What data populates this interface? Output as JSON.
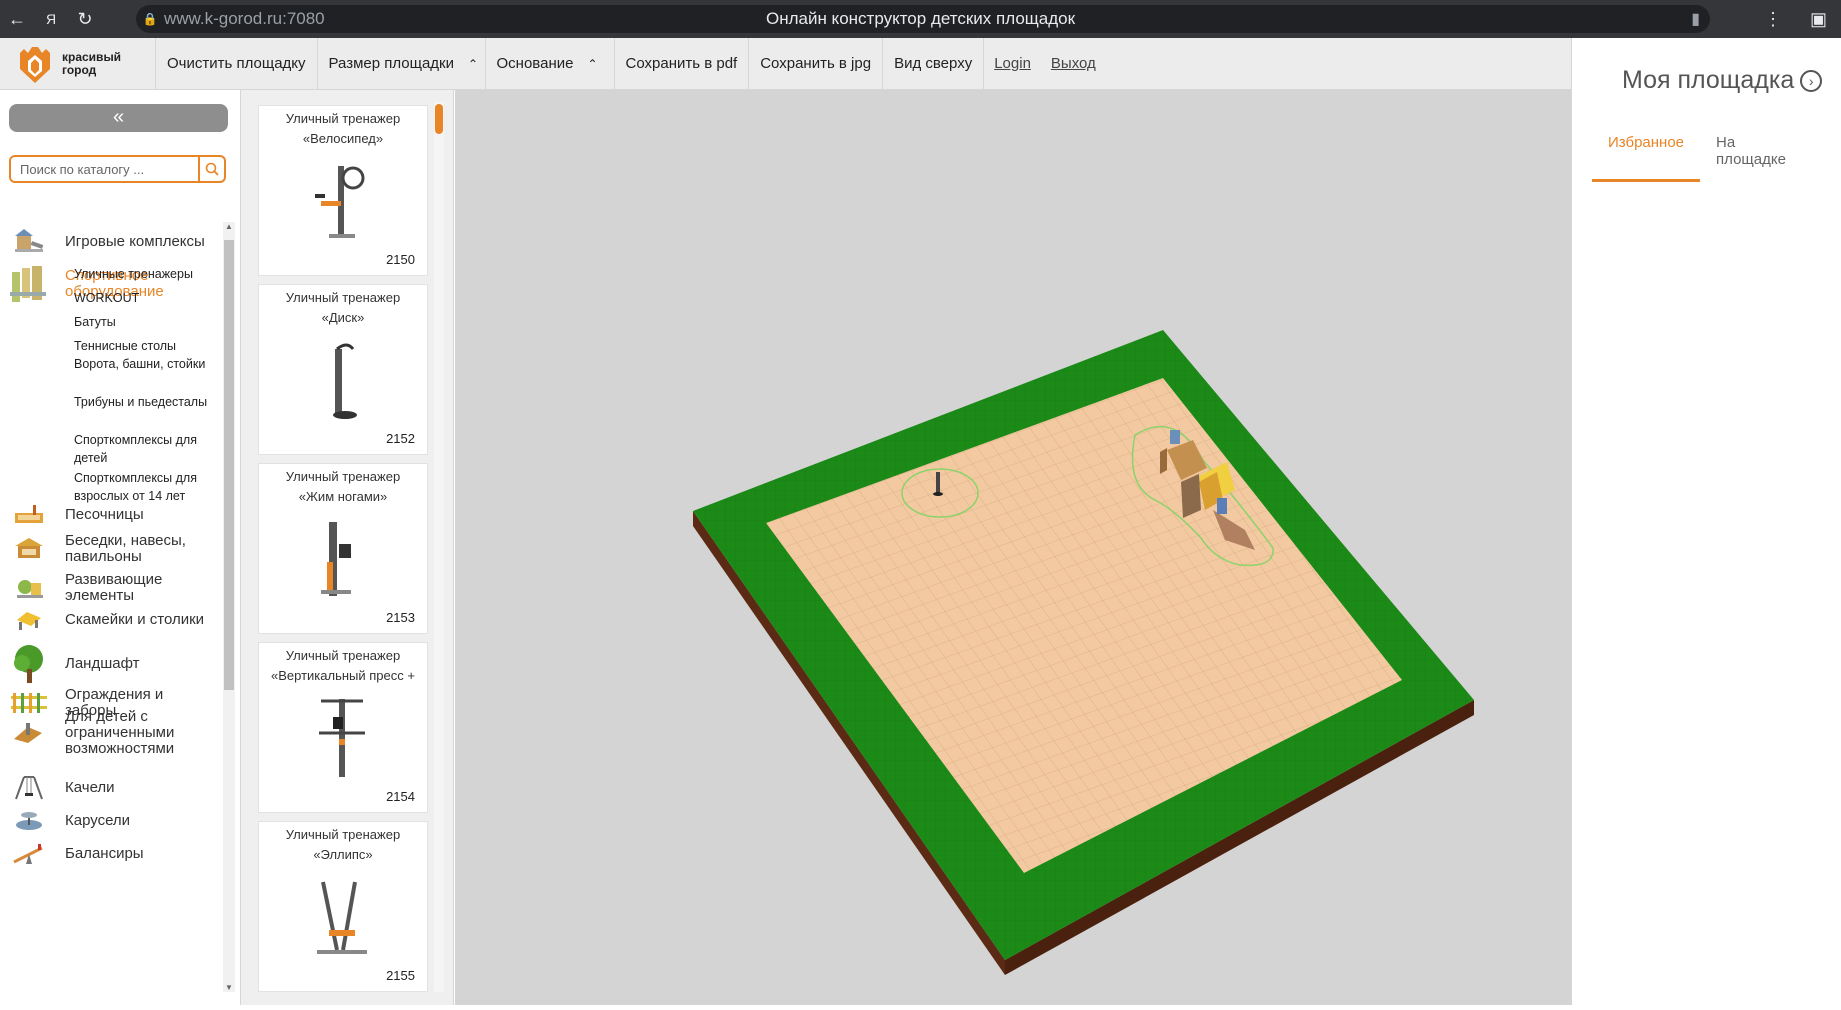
{
  "browser": {
    "url": "www.k-gorod.ru:7080",
    "page_title": "Онлайн конструктор детских площадок"
  },
  "logo": {
    "line1": "красивый",
    "line2": "город"
  },
  "toolbar": {
    "clear": "Очистить площадку",
    "size": "Размер площадки",
    "base": "Основание",
    "save_pdf": "Сохранить в pdf",
    "save_jpg": "Сохранить в jpg",
    "top_view": "Вид сверху",
    "login": "Login",
    "logout": "Выход"
  },
  "right_panel": {
    "title": "Моя площадка",
    "tabs": [
      {
        "label": "Избранное",
        "active": true
      },
      {
        "label": "На площадке",
        "active": false
      }
    ]
  },
  "sidebar": {
    "collapse": "«",
    "search_placeholder": "Поиск по каталогу ...",
    "categories": [
      {
        "label": "Игровые комплексы",
        "icon": "playground-icon"
      },
      {
        "label": "Спортивное оборудование",
        "icon": "sport-equipment-icon",
        "active": true
      },
      {
        "label": "Песочницы",
        "icon": "sandbox-icon"
      },
      {
        "label": "Беседки, навесы, павильоны",
        "icon": "gazebo-icon"
      },
      {
        "label": "Развивающие элементы",
        "icon": "educational-icon"
      },
      {
        "label": "Скамейки и столики",
        "icon": "bench-icon"
      },
      {
        "label": "Ландшафт",
        "icon": "tree-icon"
      },
      {
        "label": "Ограждения и заборы",
        "icon": "fence-icon"
      },
      {
        "label": "Для детей с ограниченными возможностями",
        "icon": "accessible-icon"
      },
      {
        "label": "Качели",
        "icon": "swing-icon"
      },
      {
        "label": "Карусели",
        "icon": "carousel-icon"
      },
      {
        "label": "Балансиры",
        "icon": "seesaw-icon"
      }
    ],
    "subcategories": [
      "Уличные тренажеры",
      "WORKOUT",
      "Батуты",
      "Теннисные столы",
      "Ворота, башни, стойки",
      "Трибуны и пьедесталы",
      "Спорткомплексы для детей",
      "Спорткомплексы для взрослых от 14 лет"
    ]
  },
  "products": [
    {
      "line1": "Уличный тренажер",
      "line2": "«Велосипед»",
      "code": "2150"
    },
    {
      "line1": "Уличный тренажер",
      "line2": "«Диск»",
      "code": "2152"
    },
    {
      "line1": "Уличный тренажер",
      "line2": "«Жим ногами»",
      "code": "2153"
    },
    {
      "line1": "Уличный тренажер",
      "line2": "«Вертикальный пресс +",
      "code": "2154"
    },
    {
      "line1": "Уличный тренажер",
      "line2": "«Эллипс»",
      "code": "2155"
    }
  ],
  "colors": {
    "accent": "#e88526",
    "grass": "#1c8a17",
    "tile": "#f2c9a0",
    "soil": "#5a2a14",
    "canvas_bg": "#d4d4d4"
  }
}
